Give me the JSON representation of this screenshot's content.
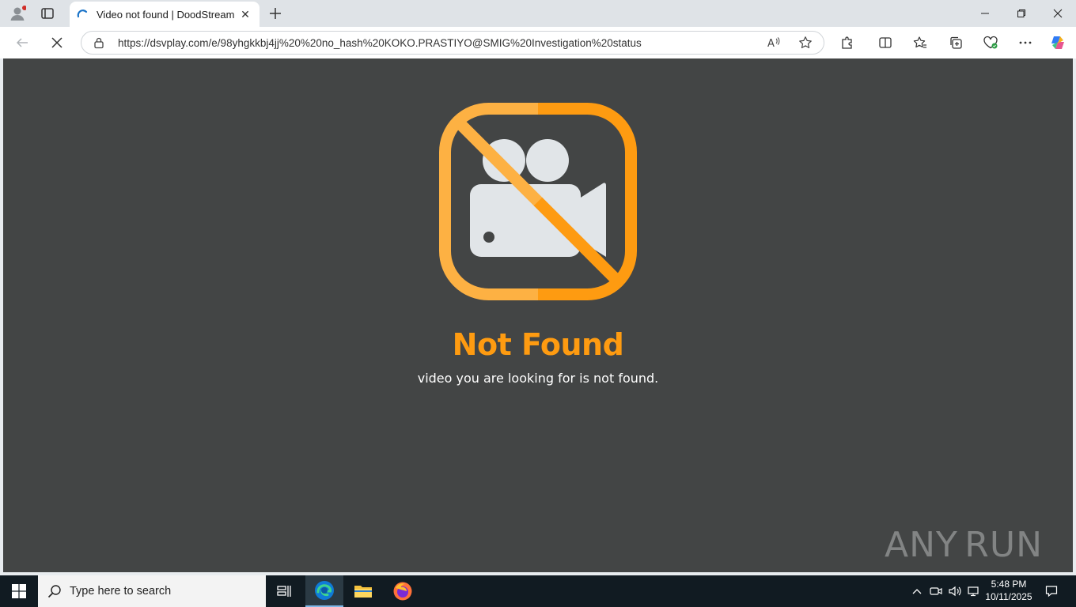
{
  "browser": {
    "tab_title": "Video not found | DoodStream",
    "url": "https://dsvplay.com/e/98yhgkkbj4jj%20%20no_hash%20KOKO.PRASTIYO@SMIG%20Investigation%20status"
  },
  "page": {
    "title": "Not Found",
    "message": "video you are looking for is not found.",
    "accent_color": "#fe9b11",
    "background_color": "#434545"
  },
  "watermark": {
    "text_left": "ANY",
    "text_right": "RUN"
  },
  "taskbar": {
    "search_placeholder": "Type here to search",
    "time": "5:48 PM",
    "date": "10/11/2025"
  }
}
